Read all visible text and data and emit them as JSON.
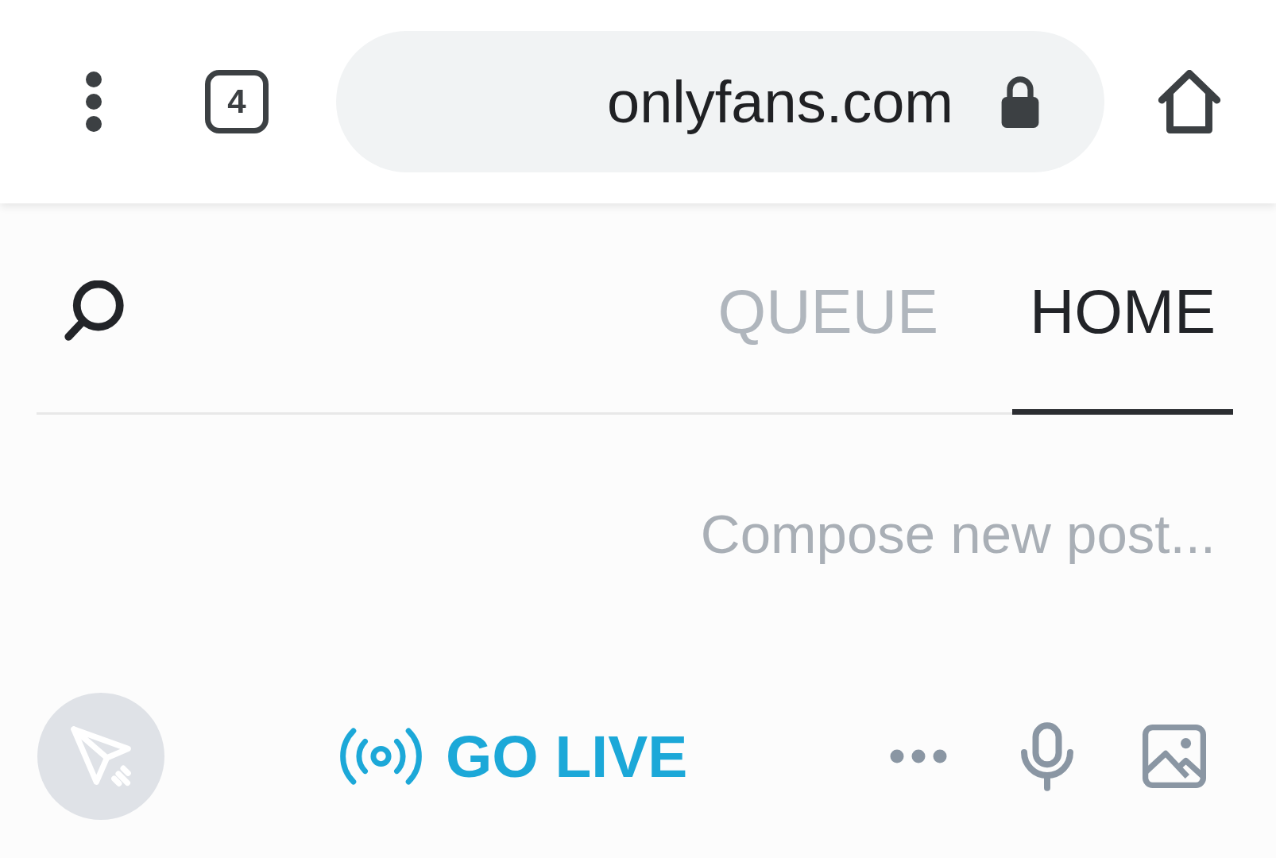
{
  "browser": {
    "url": "onlyfans.com",
    "tab_count": "4"
  },
  "tabs": [
    {
      "label": "QUEUE",
      "selected": false
    },
    {
      "label": "HOME",
      "selected": true
    }
  ],
  "composer": {
    "placeholder": "Compose new post...",
    "go_live": "GO LIVE",
    "send_button": {
      "disabled": true
    }
  }
}
